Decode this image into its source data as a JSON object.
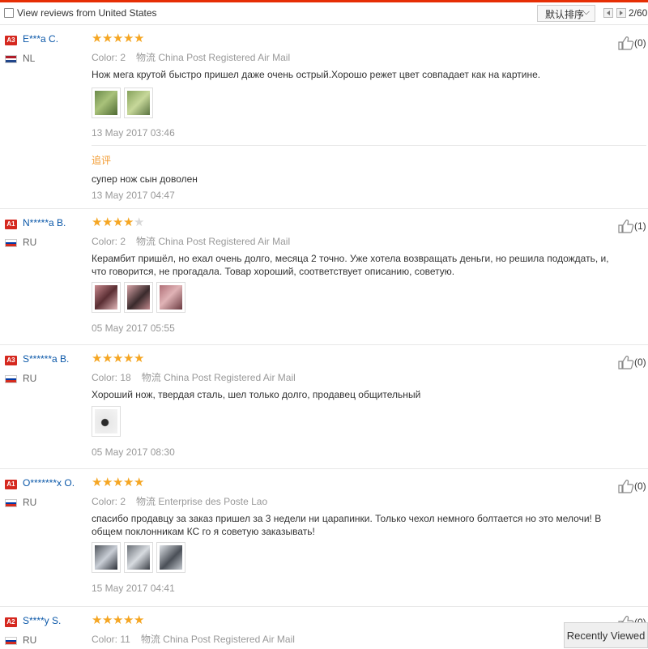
{
  "toolbar": {
    "filter_label": "View reviews from United States",
    "filter_checked": false,
    "sort_label": "默认排序",
    "page_indicator": "2/60"
  },
  "reviews": [
    {
      "level": "A3",
      "name": "E***a C.",
      "country": "NL",
      "rating": 5,
      "color": "Color: 2",
      "logistics_label": "物流",
      "shipping": "China Post Registered Air Mail",
      "text": "Нож мега крутой быстро пришел даже очень острый.Хорошо режет цвет совпадает как на картине.",
      "photo_count": 2,
      "date": "13 May 2017 03:46",
      "likes": "(0)",
      "followup": {
        "label": "追评",
        "text": "супер нож сын доволен",
        "date": "13 May 2017 04:47"
      }
    },
    {
      "level": "A1",
      "name": "N*****a B.",
      "country": "RU",
      "rating": 4,
      "color": "Color: 2",
      "logistics_label": "物流",
      "shipping": "China Post Registered Air Mail",
      "text": "Керамбит пришёл, но ехал очень долго, месяца 2 точно. Уже хотела возвращать деньги, но решила подождать, и, что говорится, не прогадала. Товар хороший, соответствует описанию, советую.",
      "photo_count": 3,
      "date": "05 May 2017 05:55",
      "likes": "(1)"
    },
    {
      "level": "A3",
      "name": "S******a B.",
      "country": "RU",
      "rating": 5,
      "color": "Color: 18",
      "logistics_label": "物流",
      "shipping": "China Post Registered Air Mail",
      "text": "Хороший нож, твердая сталь, шел только долго, продавец общительный",
      "photo_count": 1,
      "date": "05 May 2017 08:30",
      "likes": "(0)"
    },
    {
      "level": "A1",
      "name": "O*******x O.",
      "country": "RU",
      "rating": 5,
      "color": "Color: 2",
      "logistics_label": "物流",
      "shipping": "Enterprise des Poste Lao",
      "text": "спасибо продавцу за заказ пришел за 3 недели ни царапинки. Только чехол немного болтается но это мелочи! В общем поклонникам КС го я советую заказывать!",
      "photo_count": 3,
      "date": "15 May 2017 04:41",
      "likes": "(0)"
    },
    {
      "level": "A2",
      "name": "S****y S.",
      "country": "RU",
      "rating": 5,
      "color": "Color: 11",
      "logistics_label": "物流",
      "shipping": "China Post Registered Air Mail",
      "likes": "(0)"
    }
  ],
  "recently_viewed": "Recently Viewed",
  "colors": {
    "accent": "#e62e04",
    "star": "#f5a623",
    "username": "#0a57a8",
    "badge": "#d5281f",
    "followup": "#f29a2e"
  },
  "icons": [
    "checkbox",
    "chevron-down-icon",
    "prev-page-icon",
    "next-page-icon",
    "thumbs-up-icon",
    "star-icon",
    "flag-nl-icon",
    "flag-ru-icon"
  ]
}
